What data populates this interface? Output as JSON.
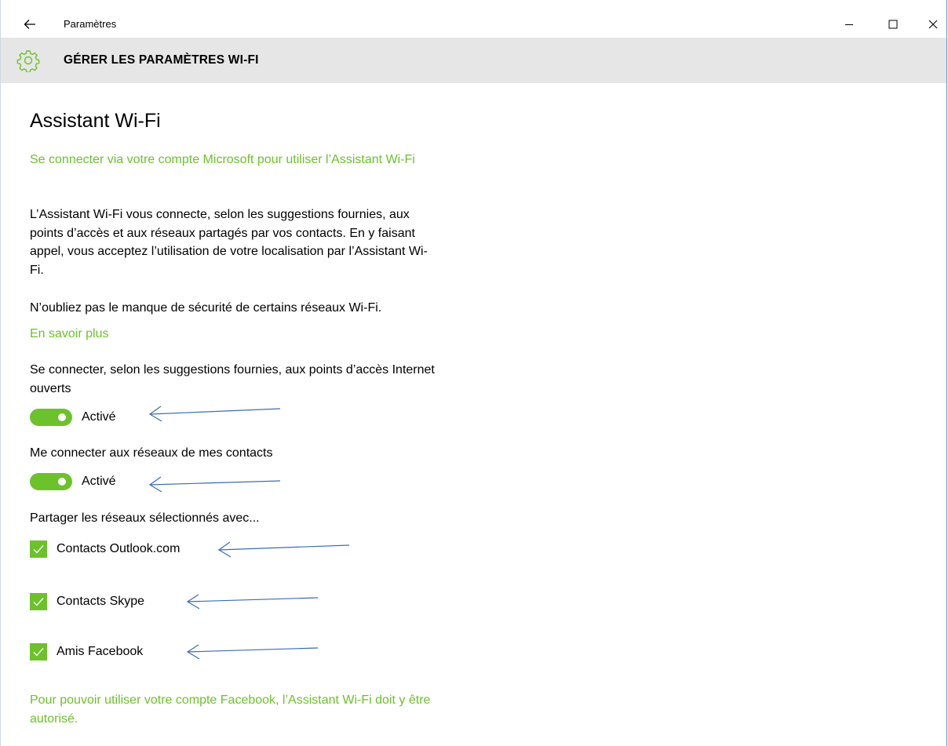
{
  "window": {
    "title": "Paramètres"
  },
  "header": {
    "title": "GÉRER LES PARAMÈTRES WI-FI"
  },
  "main": {
    "page_title": "Assistant Wi-Fi",
    "signin_link": "Se connecter via votre compte Microsoft pour utiliser l’Assistant Wi-Fi",
    "description": "L’Assistant Wi-Fi vous connecte, selon les suggestions fournies, aux points d’accès et aux réseaux partagés par vos contacts. En y faisant appel, vous acceptez l’utilisation de votre localisation par l’Assistant Wi-Fi.",
    "security_note": "N’oubliez pas le manque de sécurité de certains réseaux Wi-Fi.",
    "learn_more": "En savoir plus",
    "open_hotspots": {
      "label": "Se connecter, selon les suggestions fournies, aux points d’accès Internet ouverts",
      "state": "Activé",
      "on": true
    },
    "contacts_networks": {
      "label": "Me connecter aux réseaux de mes contacts",
      "state": "Activé",
      "on": true
    },
    "share_label": "Partager les réseaux sélectionnés avec...",
    "share_options": [
      {
        "label": "Contacts Outlook.com",
        "checked": true
      },
      {
        "label": "Contacts Skype",
        "checked": true
      },
      {
        "label": "Amis Facebook",
        "checked": true
      }
    ],
    "facebook_note": "Pour pouvoir utiliser votre compte Facebook, l’Assistant Wi-Fi doit y être autorisé."
  },
  "colors": {
    "accent": "#6cc22a",
    "header_bg": "#e6e6e6",
    "annotation_arrow": "#3a6db5"
  },
  "icons": {
    "back": "back-arrow-icon",
    "minimize": "minimize-icon",
    "maximize": "maximize-icon",
    "close": "close-icon",
    "settings": "gear-icon",
    "checkmark": "checkmark-icon",
    "annotation": "annotation-arrow-icon"
  }
}
